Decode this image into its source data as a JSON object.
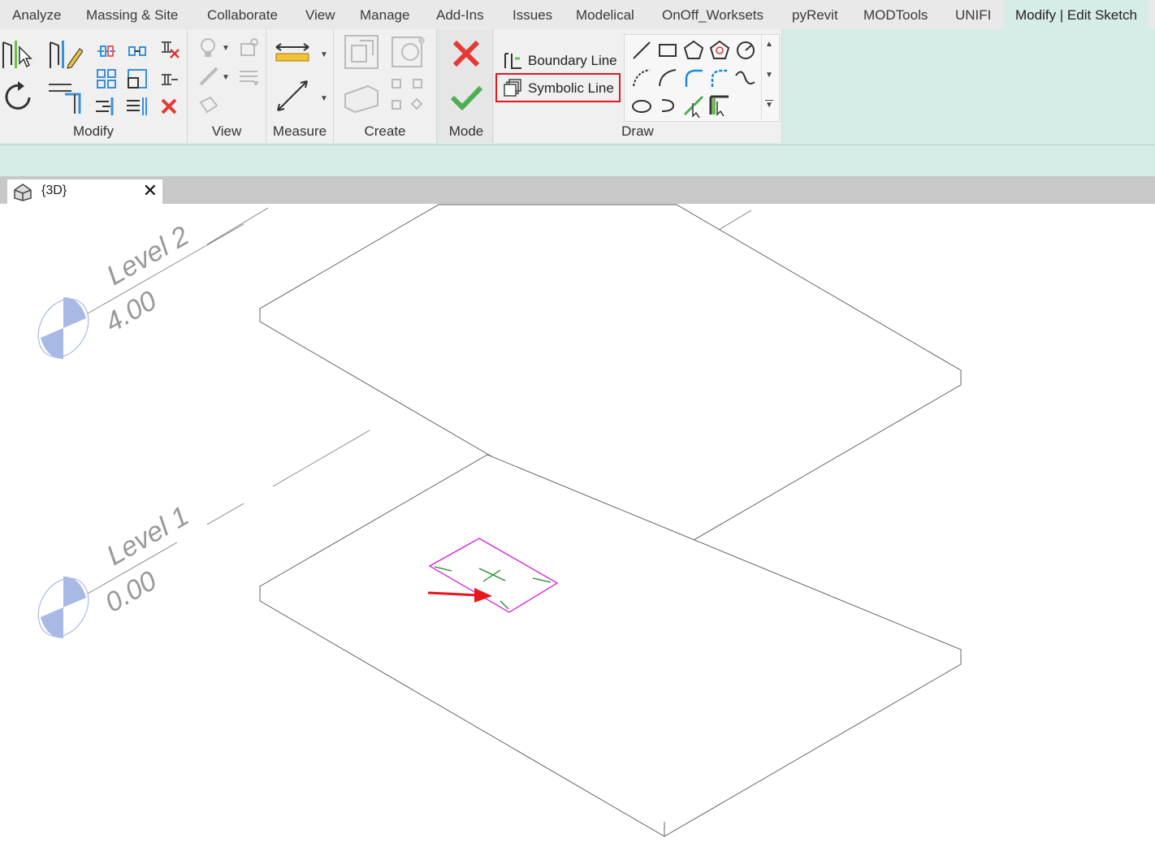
{
  "ribbon": {
    "tabs": [
      {
        "label": "Analyze",
        "active": false
      },
      {
        "label": "Massing & Site",
        "active": false
      },
      {
        "label": "Collaborate",
        "active": false
      },
      {
        "label": "View",
        "active": false
      },
      {
        "label": "Manage",
        "active": false
      },
      {
        "label": "Add-Ins",
        "active": false
      },
      {
        "label": "Issues",
        "active": false
      },
      {
        "label": "Modelical",
        "active": false
      },
      {
        "label": "OnOff_Worksets",
        "active": false
      },
      {
        "label": "pyRevit",
        "active": false
      },
      {
        "label": "MODTools",
        "active": false
      },
      {
        "label": "UNIFI",
        "active": false
      },
      {
        "label": "Modify | Edit Sketch",
        "active": true
      }
    ],
    "panels": {
      "modify": "Modify",
      "view": "View",
      "measure": "Measure",
      "create": "Create",
      "mode": "Mode",
      "draw": "Draw"
    },
    "draw": {
      "boundary_line": "Boundary Line",
      "symbolic_line": "Symbolic Line",
      "highlighted": "Symbolic Line"
    }
  },
  "view_tab": {
    "label": "{3D}",
    "close_glyph": "✕"
  },
  "viewport": {
    "levels": [
      {
        "name": "Level 2",
        "elevation": "4.00"
      },
      {
        "name": "Level 1",
        "elevation": "0.00"
      }
    ]
  },
  "colors": {
    "ribbon_bg": "#d6ece8",
    "highlight_box": "#e8151d",
    "sketch_line": "#d21bd6",
    "sketch_marks": "#1a8a2a",
    "arrow": "#e8151d",
    "level_head": "#a9b9e6",
    "cancel": "#e53935",
    "finish": "#4caf50"
  }
}
